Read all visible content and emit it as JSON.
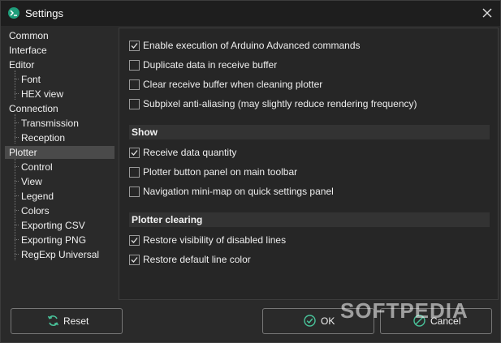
{
  "window": {
    "title": "Settings"
  },
  "sidebar": {
    "items": [
      {
        "label": "Common",
        "level": 0
      },
      {
        "label": "Interface",
        "level": 0
      },
      {
        "label": "Editor",
        "level": 0
      },
      {
        "label": "Font",
        "level": 1
      },
      {
        "label": "HEX view",
        "level": 1
      },
      {
        "label": "Connection",
        "level": 0
      },
      {
        "label": "Transmission",
        "level": 1
      },
      {
        "label": "Reception",
        "level": 1
      },
      {
        "label": "Plotter",
        "level": 0,
        "selected": true
      },
      {
        "label": "Control",
        "level": 1
      },
      {
        "label": "View",
        "level": 1
      },
      {
        "label": "Legend",
        "level": 1
      },
      {
        "label": "Colors",
        "level": 1
      },
      {
        "label": "Exporting CSV",
        "level": 1
      },
      {
        "label": "Exporting PNG",
        "level": 1
      },
      {
        "label": "RegExp Universal",
        "level": 1
      }
    ]
  },
  "panel": {
    "general": [
      {
        "label": "Enable execution of Arduino Advanced commands",
        "checked": true
      },
      {
        "label": "Duplicate data in receive buffer",
        "checked": false
      },
      {
        "label": "Clear receive buffer when cleaning plotter",
        "checked": false
      },
      {
        "label": "Subpixel anti-aliasing (may slightly reduce rendering frequency)",
        "checked": false
      }
    ],
    "show_header": "Show",
    "show": [
      {
        "label": "Receive data quantity",
        "checked": true
      },
      {
        "label": "Plotter button panel on main toolbar",
        "checked": false
      },
      {
        "label": "Navigation mini-map on quick settings panel",
        "checked": false
      }
    ],
    "clearing_header": "Plotter clearing",
    "clearing": [
      {
        "label": "Restore visibility of disabled lines",
        "checked": true
      },
      {
        "label": "Restore default line color",
        "checked": true
      }
    ]
  },
  "buttons": {
    "reset": "Reset",
    "ok": "OK",
    "cancel": "Cancel"
  },
  "watermark": "SOFTPEDIA",
  "icons": {
    "app": "terminal-icon",
    "close": "close-icon",
    "reset": "refresh-icon",
    "ok": "check-circle-icon",
    "cancel": "cancel-circle-icon"
  },
  "colors": {
    "accent": "#1f9e7b",
    "selection": "#4a4a4a",
    "background": "#2a2a2a"
  }
}
